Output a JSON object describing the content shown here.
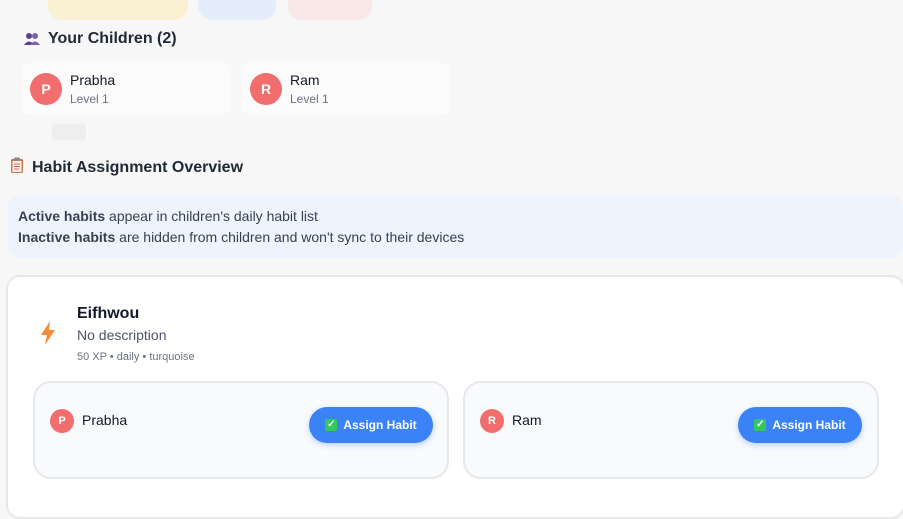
{
  "children_section": {
    "title": "Your Children (2)",
    "children": [
      {
        "initial": "P",
        "name": "Prabha",
        "level": "Level 1"
      },
      {
        "initial": "R",
        "name": "Ram",
        "level": "Level 1"
      }
    ]
  },
  "overview": {
    "title": "Habit Assignment Overview",
    "info": {
      "active_bold": "Active habits",
      "active_text": " appear in children's daily habit list",
      "inactive_bold": "Inactive habits",
      "inactive_text": " are hidden from children and won't sync to their devices"
    }
  },
  "habit": {
    "name": "Eifhwou",
    "description": "No description",
    "meta": "50 XP • daily • turquoise",
    "assignments": [
      {
        "initial": "P",
        "name": "Prabha",
        "button": "Assign Habit"
      },
      {
        "initial": "R",
        "name": "Ram",
        "button": "Assign Habit"
      }
    ]
  },
  "colors": {
    "accent": "#3b82f6",
    "avatar": "#f26d6d",
    "info_bg": "#eef4fe"
  },
  "icons": {
    "children": "people-icon",
    "overview": "clipboard-icon",
    "habit": "lightning-icon",
    "button": "check-icon"
  }
}
